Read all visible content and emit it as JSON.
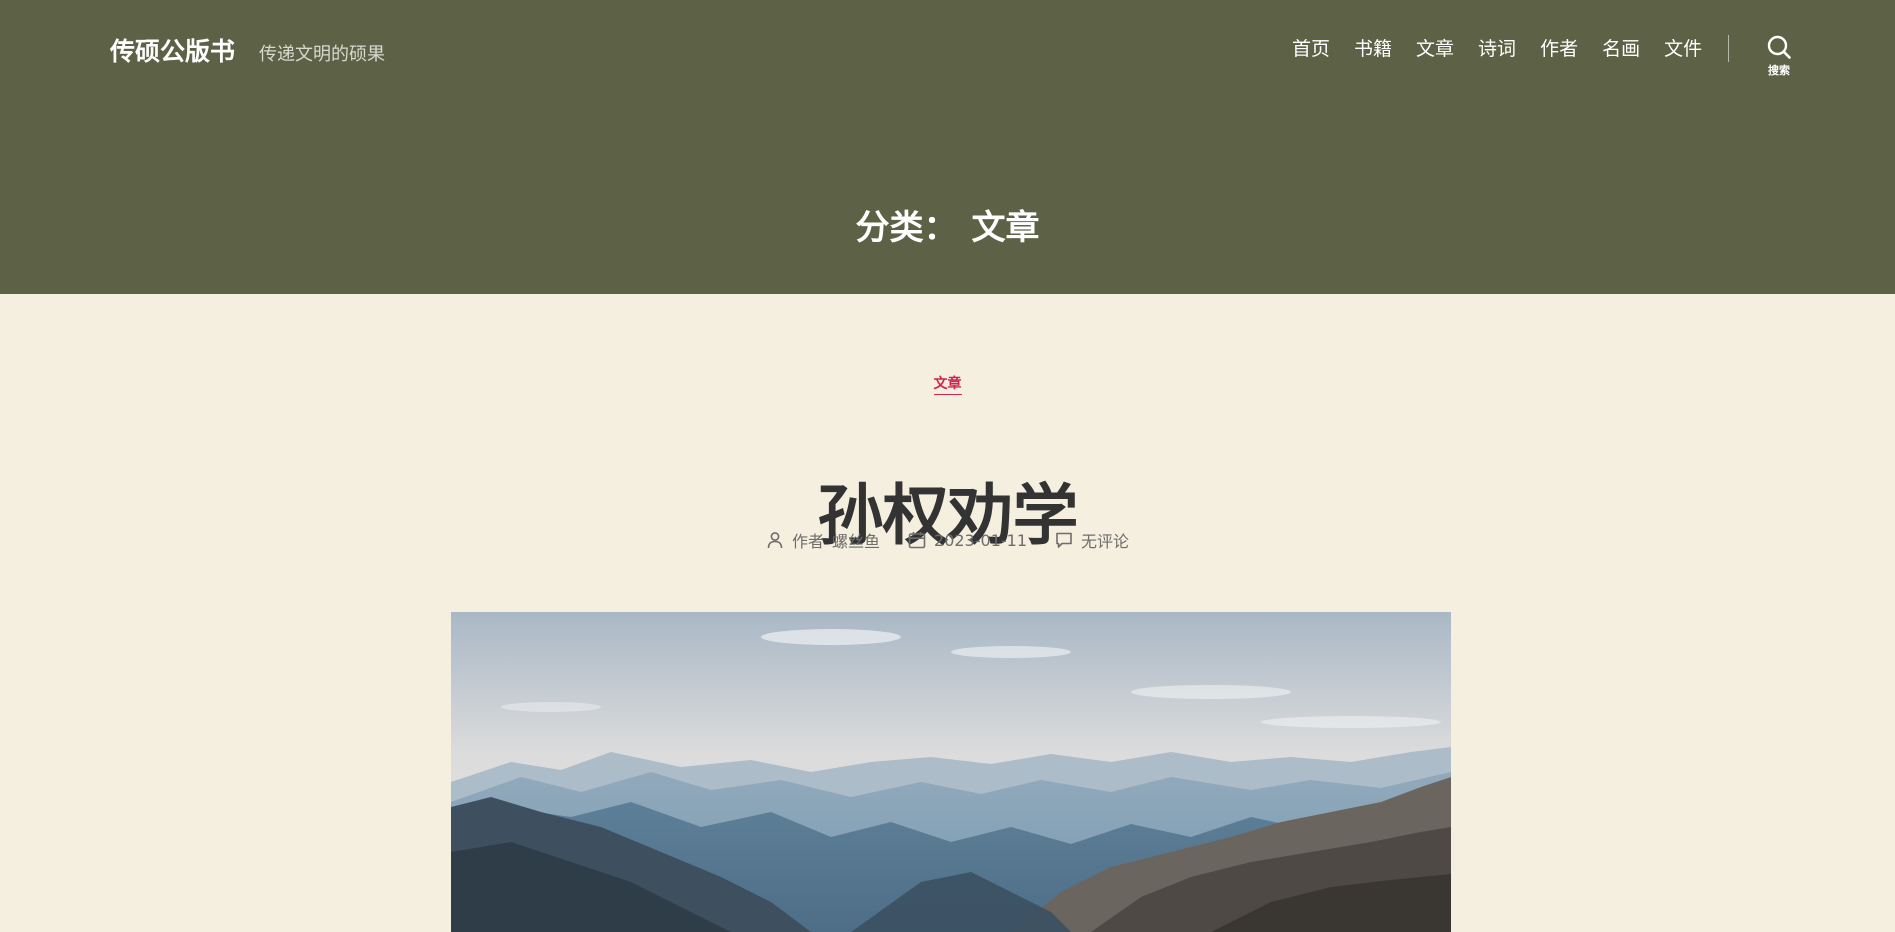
{
  "site": {
    "title": "传硕公版书",
    "tagline": "传递文明的硕果"
  },
  "nav": {
    "items": [
      "首页",
      "书籍",
      "文章",
      "诗词",
      "作者",
      "名画",
      "文件"
    ],
    "search_label": "搜索"
  },
  "archive": {
    "prefix": "分类：",
    "name": "文章"
  },
  "post": {
    "category": "文章",
    "title": "孙权劝学",
    "author_prefix": "作者",
    "author": "螺丝鱼",
    "date": "2023-01-11",
    "comments": "无评论"
  },
  "colors": {
    "header_bg": "#5d6246",
    "page_bg": "#f5efe0",
    "accent": "#cd2653",
    "title": "#333333"
  },
  "icons": {
    "search": "search-icon",
    "author": "person-icon",
    "date": "calendar-icon",
    "comments": "comment-icon"
  }
}
